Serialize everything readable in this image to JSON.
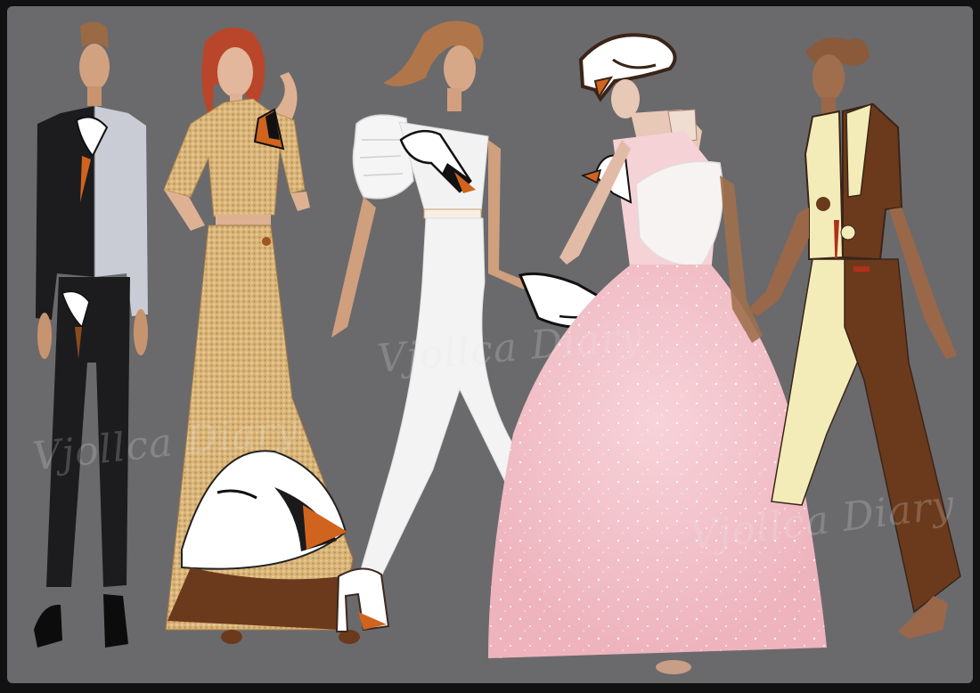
{
  "watermark": {
    "text_1": "Vjollca Diary",
    "text_2": "Vjollca Diary",
    "text_3": "Vjollca Diary"
  },
  "palette": {
    "background": "#6a6a6c",
    "border": "#111111",
    "skin_light": "#d9a98a",
    "skin_dark": "#a0704e",
    "hair_red": "#b9462a",
    "hair_brown": "#8a5a3a",
    "tweed": "#d9b57a",
    "suit_black": "#1c1c1e",
    "suit_grey": "#c9ccd4",
    "white_look": "#f1f1f1",
    "pink_gown": "#f2c0c8",
    "cream": "#f3ecb8",
    "brown": "#6b3a1c",
    "beak_orange": "#d0641e"
  },
  "figures": [
    {
      "id": "figure-1",
      "look": "black-and-grey-suit"
    },
    {
      "id": "figure-2",
      "look": "tweed-crop-top-and-maxi-skirt"
    },
    {
      "id": "figure-3",
      "look": "white-swan-jumpsuit"
    },
    {
      "id": "figure-4",
      "look": "pink-tulle-gown-with-swan-hat"
    },
    {
      "id": "figure-5",
      "look": "cream-and-brown-split-suit"
    }
  ]
}
